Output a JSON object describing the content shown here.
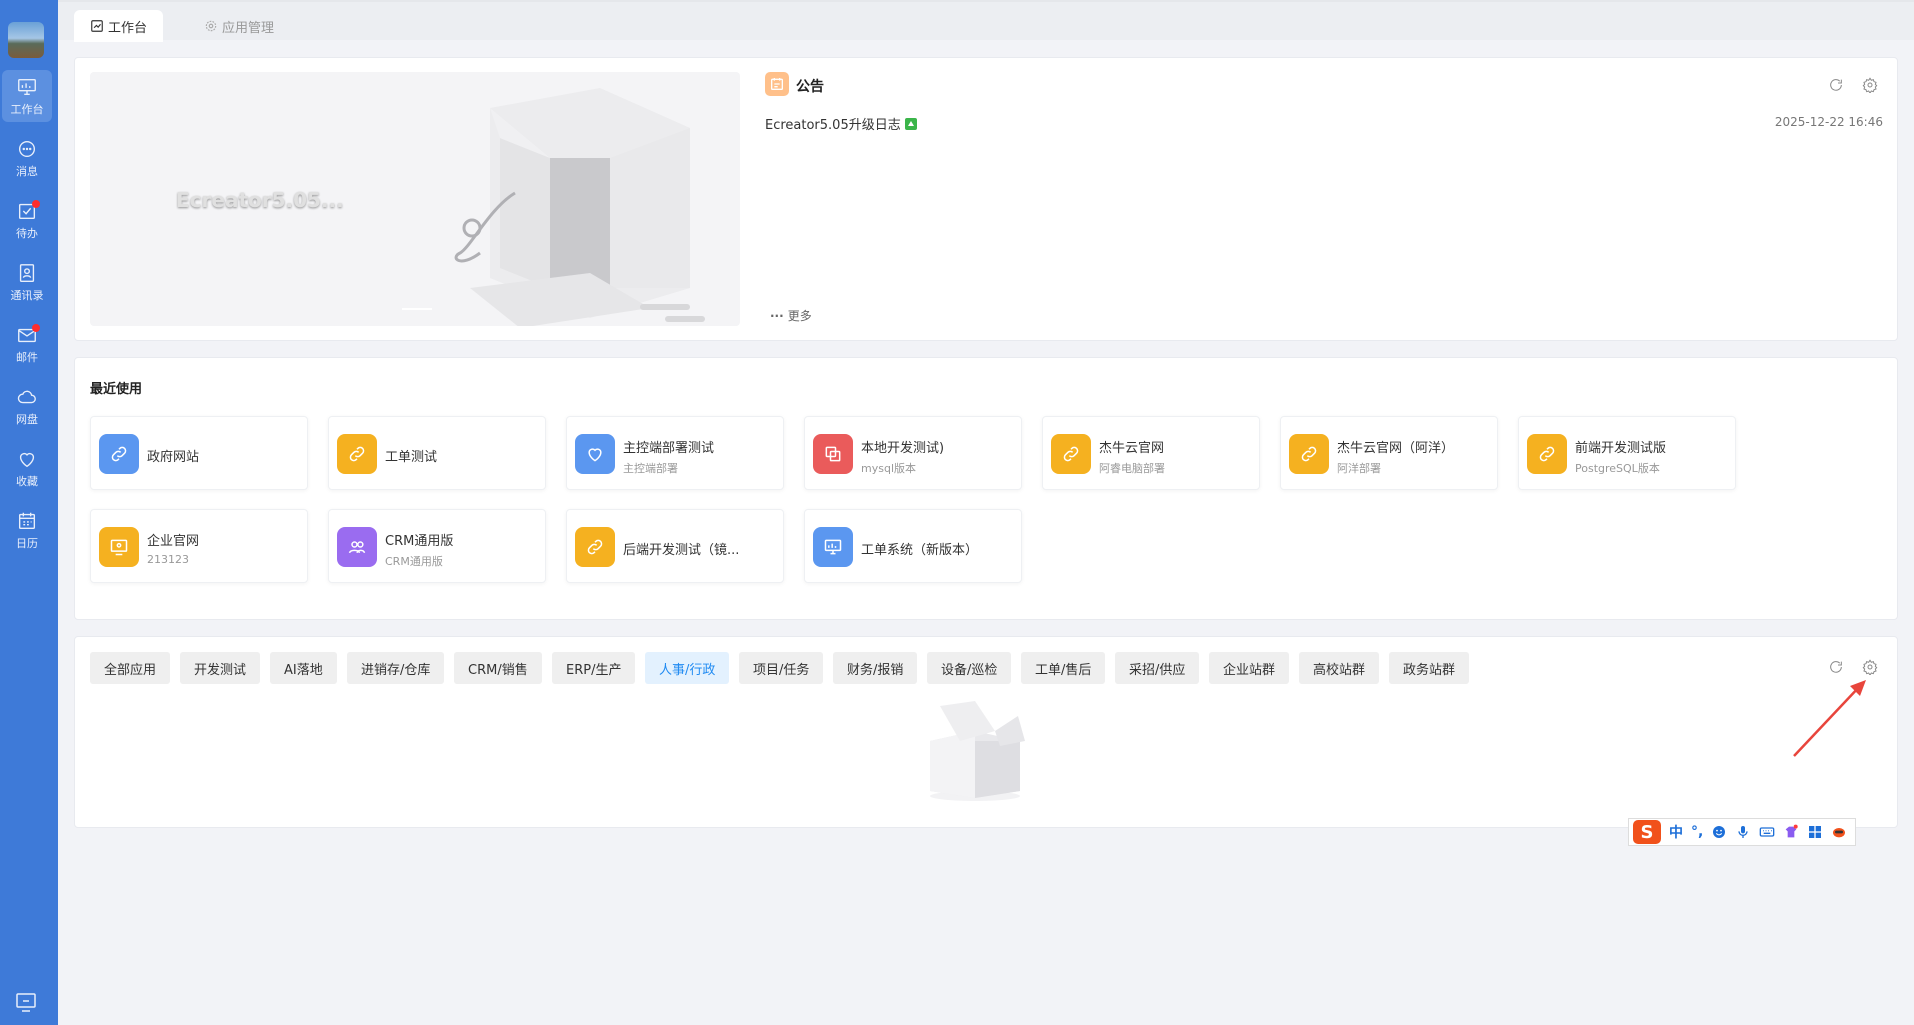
{
  "sidebar": {
    "items": [
      {
        "label": "工作台",
        "icon": "dashboard-icon"
      },
      {
        "label": "消息",
        "icon": "message-icon"
      },
      {
        "label": "待办",
        "icon": "todo-icon"
      },
      {
        "label": "通讯录",
        "icon": "contacts-icon"
      },
      {
        "label": "邮件",
        "icon": "mail-icon"
      },
      {
        "label": "网盘",
        "icon": "cloud-icon"
      },
      {
        "label": "收藏",
        "icon": "heart-icon"
      },
      {
        "label": "日历",
        "icon": "calendar-icon"
      }
    ]
  },
  "tabs": [
    {
      "label": "工作台",
      "active": true
    },
    {
      "label": "应用管理",
      "active": false
    }
  ],
  "banner": {
    "title": "Ecreator5.05..."
  },
  "announcement": {
    "title": "公告",
    "item_title": "Ecreator5.05升级日志",
    "item_date": "2025-12-22 16:46",
    "more": "更多"
  },
  "recent": {
    "title": "最近使用",
    "apps": [
      {
        "name": "政府网站",
        "sub": "",
        "color": "#5b97f0",
        "icon": "link-icon"
      },
      {
        "name": "工单测试",
        "sub": "",
        "color": "#f5b120",
        "icon": "link-icon"
      },
      {
        "name": "主控端部署测试",
        "sub": "主控端部署",
        "color": "#5b97f0",
        "icon": "heart-refresh-icon"
      },
      {
        "name": "本地开发测试)",
        "sub": "mysql版本",
        "color": "#ea5b5b",
        "icon": "copy-icon"
      },
      {
        "name": "杰牛云官网",
        "sub": "阿睿电脑部署",
        "color": "#f5b120",
        "icon": "link-icon"
      },
      {
        "name": "杰牛云官网（阿洋）",
        "sub": "阿洋部署",
        "color": "#f5b120",
        "icon": "link-icon"
      },
      {
        "name": "前端开发测试版",
        "sub": "PostgreSQL版本",
        "color": "#f5b120",
        "icon": "link-icon"
      },
      {
        "name": "企业官网",
        "sub": "213123",
        "color": "#f5b120",
        "icon": "monitor-icon"
      },
      {
        "name": "CRM通用版",
        "sub": "CRM通用版",
        "color": "#9a6cf0",
        "icon": "users-icon"
      },
      {
        "name": "后端开发测试（镜...",
        "sub": "",
        "color": "#f5b120",
        "icon": "link-icon"
      },
      {
        "name": "工单系统（新版本）",
        "sub": "",
        "color": "#5b97f0",
        "icon": "chart-board-icon"
      }
    ]
  },
  "categories": [
    {
      "label": "全部应用",
      "active": false
    },
    {
      "label": "开发测试",
      "active": false
    },
    {
      "label": "AI落地",
      "active": false
    },
    {
      "label": "进销存/仓库",
      "active": false
    },
    {
      "label": "CRM/销售",
      "active": false
    },
    {
      "label": "ERP/生产",
      "active": false
    },
    {
      "label": "人事/行政",
      "active": true
    },
    {
      "label": "项目/任务",
      "active": false
    },
    {
      "label": "财务/报销",
      "active": false
    },
    {
      "label": "设备/巡检",
      "active": false
    },
    {
      "label": "工单/售后",
      "active": false
    },
    {
      "label": "采招/供应",
      "active": false
    },
    {
      "label": "企业站群",
      "active": false
    },
    {
      "label": "高校站群",
      "active": false
    },
    {
      "label": "政务站群",
      "active": false
    }
  ],
  "ime": {
    "mode": "中",
    "punct": "°,"
  }
}
